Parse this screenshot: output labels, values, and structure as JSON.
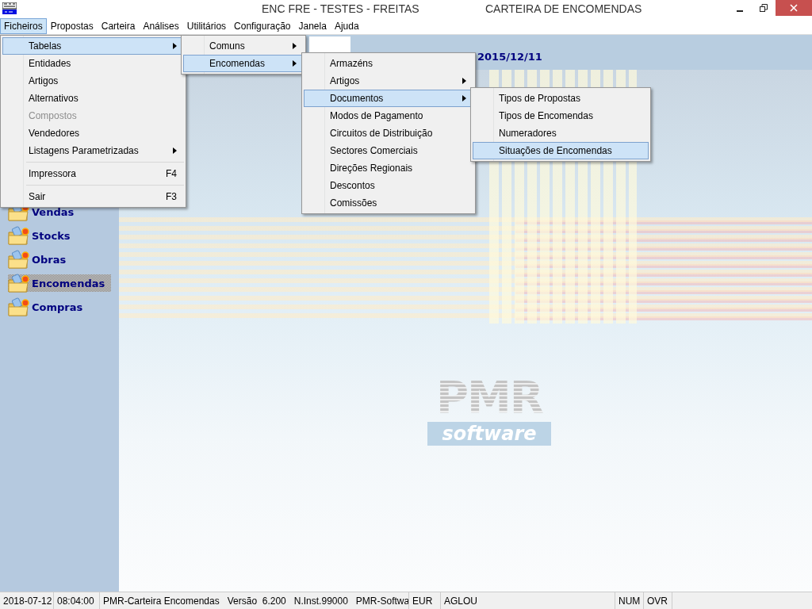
{
  "window": {
    "title": "ENC FRE - TESTES - FREITAS",
    "subtitle": "CARTEIRA DE ENCOMENDAS"
  },
  "menubar": [
    {
      "label": "Ficheiros",
      "selected": true
    },
    {
      "label": "Propostas",
      "selected": false
    },
    {
      "label": "Carteira",
      "selected": false
    },
    {
      "label": "Análises",
      "selected": false
    },
    {
      "label": "Utilitários",
      "selected": false
    },
    {
      "label": "Configuração",
      "selected": false
    },
    {
      "label": "Janela",
      "selected": false
    },
    {
      "label": "Ajuda",
      "selected": false
    }
  ],
  "header": {
    "date": "2015/12/11"
  },
  "sidebar": {
    "items": [
      {
        "label": "Vendas",
        "selected": false
      },
      {
        "label": "Stocks",
        "selected": false
      },
      {
        "label": "Obras",
        "selected": false
      },
      {
        "label": "Encomendas",
        "selected": true
      },
      {
        "label": "Compras",
        "selected": false
      }
    ]
  },
  "logo": {
    "brand": "PMR",
    "tagline": "software"
  },
  "menus": [
    {
      "groups": [
        [
          {
            "label": "Tabelas",
            "submenu": true,
            "selected": true,
            "disabled": false
          },
          {
            "label": "Entidades",
            "submenu": false,
            "selected": false,
            "disabled": false
          },
          {
            "label": "Artigos",
            "submenu": false,
            "selected": false,
            "disabled": false
          },
          {
            "label": "Alternativos",
            "submenu": false,
            "selected": false,
            "disabled": false
          },
          {
            "label": "Compostos",
            "submenu": false,
            "selected": false,
            "disabled": true
          },
          {
            "label": "Vendedores",
            "submenu": false,
            "selected": false,
            "disabled": false
          },
          {
            "label": "Listagens Parametrizadas",
            "submenu": true,
            "selected": false,
            "disabled": false
          }
        ],
        [
          {
            "label": "Impressora",
            "shortcut": "F4",
            "submenu": false,
            "selected": false,
            "disabled": false
          }
        ],
        [
          {
            "label": "Sair",
            "shortcut": "F3",
            "submenu": false,
            "selected": false,
            "disabled": false
          }
        ]
      ]
    },
    {
      "groups": [
        [
          {
            "label": "Comuns",
            "submenu": true,
            "selected": false,
            "disabled": false
          },
          {
            "label": "Encomendas",
            "submenu": true,
            "selected": true,
            "disabled": false
          }
        ]
      ]
    },
    {
      "groups": [
        [
          {
            "label": "Armazéns",
            "submenu": false,
            "selected": false,
            "disabled": false
          },
          {
            "label": "Artigos",
            "submenu": true,
            "selected": false,
            "disabled": false
          },
          {
            "label": "Documentos",
            "submenu": true,
            "selected": true,
            "disabled": false
          },
          {
            "label": "Modos de Pagamento",
            "submenu": false,
            "selected": false,
            "disabled": false
          },
          {
            "label": "Circuitos de Distribuição",
            "submenu": false,
            "selected": false,
            "disabled": false
          },
          {
            "label": "Sectores Comerciais",
            "submenu": false,
            "selected": false,
            "disabled": false
          },
          {
            "label": "Direções Regionais",
            "submenu": false,
            "selected": false,
            "disabled": false
          },
          {
            "label": "Descontos",
            "submenu": false,
            "selected": false,
            "disabled": false
          },
          {
            "label": "Comissões",
            "submenu": false,
            "selected": false,
            "disabled": false
          }
        ]
      ]
    },
    {
      "groups": [
        [
          {
            "label": "Tipos de Propostas",
            "submenu": false,
            "selected": false,
            "disabled": false
          },
          {
            "label": "Tipos de Encomendas",
            "submenu": false,
            "selected": false,
            "disabled": false
          },
          {
            "label": "Numeradores",
            "submenu": false,
            "selected": false,
            "disabled": false
          },
          {
            "label": "Situações de Encomendas",
            "submenu": false,
            "selected": true,
            "disabled": false
          }
        ]
      ]
    }
  ],
  "status_bar": [
    {
      "text": "2018-07-12"
    },
    {
      "text": "08:04:00"
    },
    {
      "text": "PMR-Carteira Encomendas   Versão  6.200   N.Inst.99000   PMR-Softwa"
    },
    {
      "text": "EUR"
    },
    {
      "text": "AGLOU"
    },
    {
      "text": "NUM"
    },
    {
      "text": "OVR"
    }
  ]
}
